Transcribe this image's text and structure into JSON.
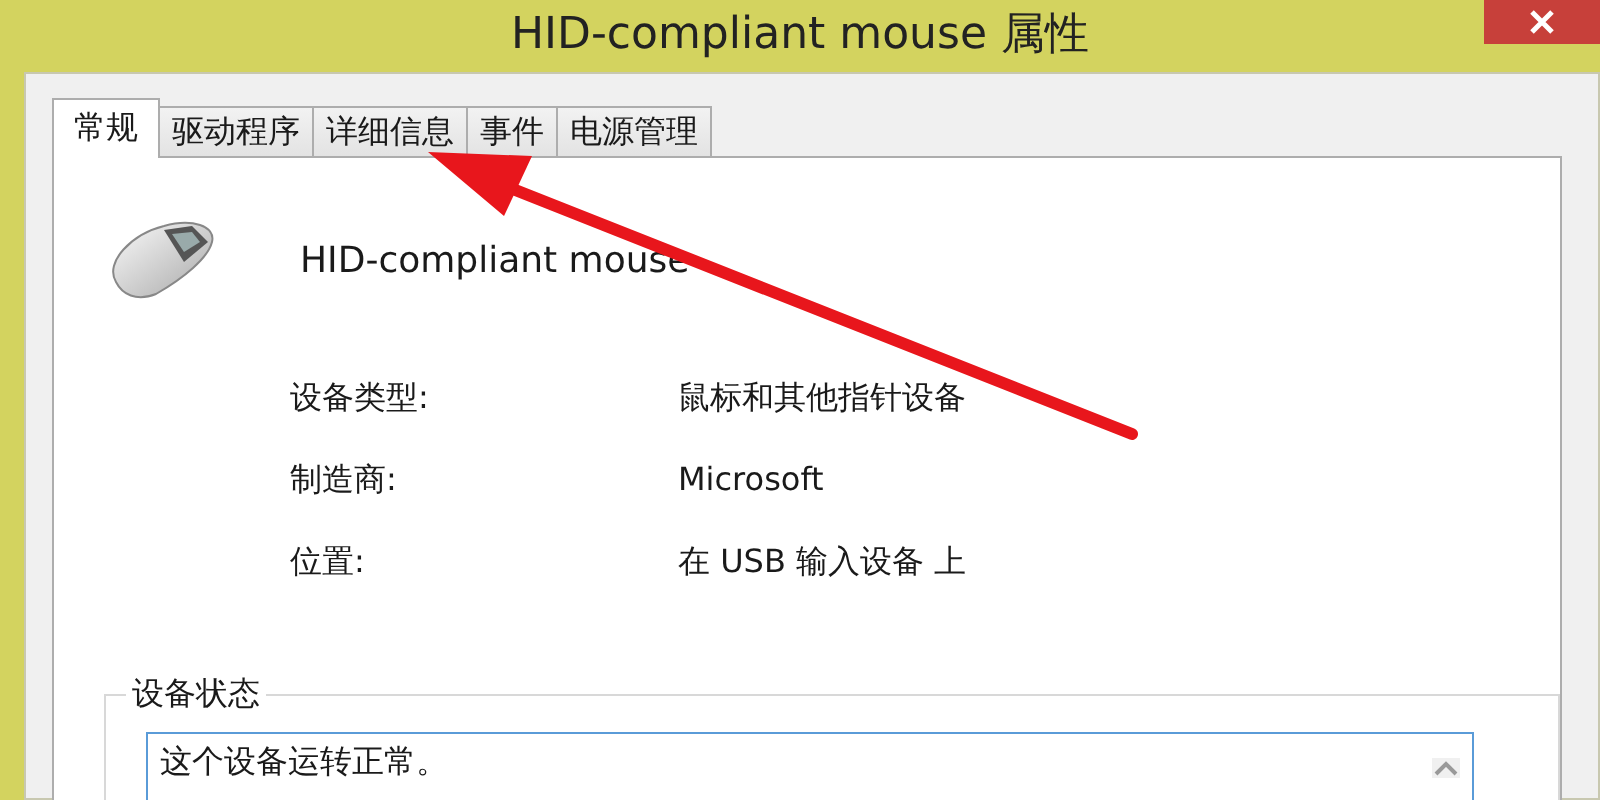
{
  "window": {
    "title": "HID-compliant mouse 属性"
  },
  "tabs": [
    {
      "label": "常规",
      "selected": true
    },
    {
      "label": "驱动程序",
      "selected": false
    },
    {
      "label": "详细信息",
      "selected": false
    },
    {
      "label": "事件",
      "selected": false
    },
    {
      "label": "电源管理",
      "selected": false
    }
  ],
  "device": {
    "name": "HID-compliant mouse"
  },
  "properties": [
    {
      "label": "设备类型:",
      "value": "鼠标和其他指针设备"
    },
    {
      "label": "制造商:",
      "value": "Microsoft"
    },
    {
      "label": "位置:",
      "value": "在 USB 输入设备 上"
    }
  ],
  "device_status": {
    "title": "设备状态",
    "value": "这个设备运转正常。"
  }
}
